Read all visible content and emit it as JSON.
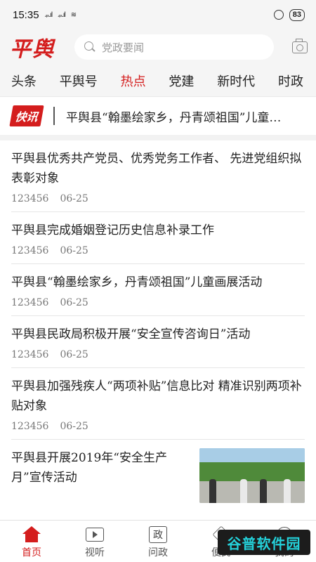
{
  "status_bar": {
    "time": "15:35",
    "signal1": "₄ₛ.ıl",
    "signal2": "₄ₛ.ıl",
    "wifi": "≋",
    "battery": "83"
  },
  "header": {
    "logo": "平舆",
    "search_placeholder": "党政要闻"
  },
  "tabs": [
    {
      "label": "头条"
    },
    {
      "label": "平舆号"
    },
    {
      "label": "热点"
    },
    {
      "label": "党建"
    },
    {
      "label": "新时代"
    },
    {
      "label": "时政"
    }
  ],
  "active_tab": "热点",
  "flash": {
    "badge": "快讯",
    "text": "平舆县“翰墨绘家乡，丹青颂祖国”儿童…"
  },
  "news": [
    {
      "title": "平舆县优秀共产党员、优秀党务工作者、 先进党组织拟表彰对象",
      "source": "123456",
      "date": "06-25"
    },
    {
      "title": "平舆县完成婚姻登记历史信息补录工作",
      "source": "123456",
      "date": "06-25"
    },
    {
      "title": "平舆县“翰墨绘家乡，丹青颂祖国”儿童画展活动",
      "source": "123456",
      "date": "06-25"
    },
    {
      "title": "平舆县民政局积极开展“安全宣传咨询日”活动",
      "source": "123456",
      "date": "06-25"
    },
    {
      "title": "平舆县加强残疾人“两项补贴”信息比对 精准识别两项补贴对象",
      "source": "123456",
      "date": "06-25"
    },
    {
      "title": "平舆县开展2019年“安全生产月”宣传活动"
    }
  ],
  "bottom_nav": [
    {
      "label": "首页"
    },
    {
      "label": "视听"
    },
    {
      "label": "问政",
      "icon_text": "政"
    },
    {
      "label": "便民"
    },
    {
      "label": "我的"
    }
  ],
  "watermark": "谷普软件园",
  "colors": {
    "accent": "#d41d1d",
    "background": "#f5f5f5"
  }
}
